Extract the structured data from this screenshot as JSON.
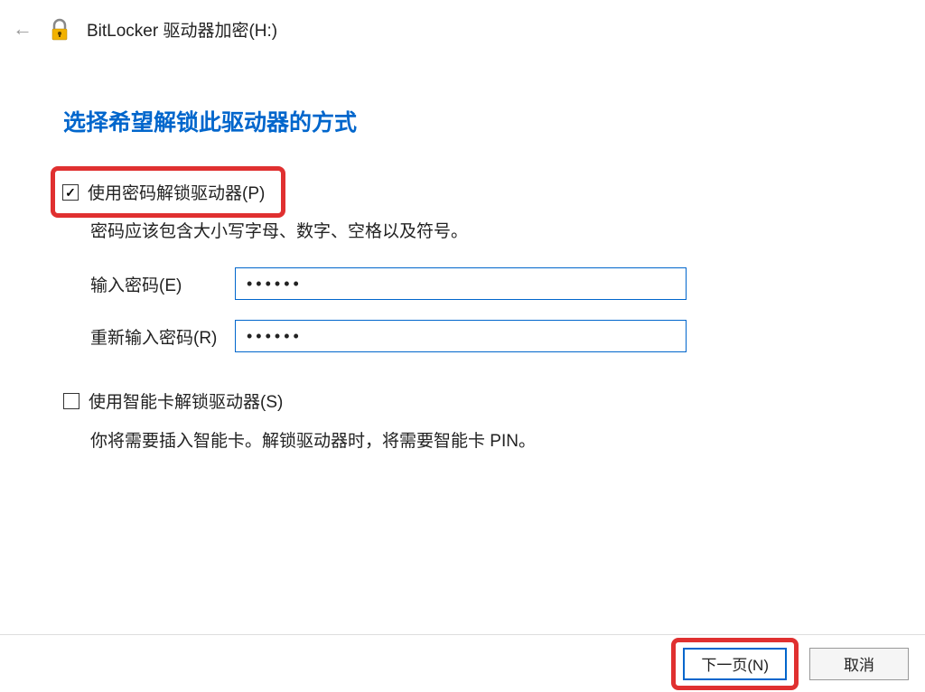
{
  "header": {
    "title": "BitLocker 驱动器加密(H:)"
  },
  "main": {
    "heading": "选择希望解锁此驱动器的方式",
    "usePassword": {
      "label": "使用密码解锁驱动器(P)",
      "checked": true,
      "desc": "密码应该包含大小写字母、数字、空格以及符号。",
      "enterLabel": "输入密码(E)",
      "enterValue": "••••••",
      "reenterLabel": "重新输入密码(R)",
      "reenterValue": "••••••"
    },
    "useSmartcard": {
      "label": "使用智能卡解锁驱动器(S)",
      "checked": false,
      "desc": "你将需要插入智能卡。解锁驱动器时，将需要智能卡 PIN。"
    }
  },
  "footer": {
    "next": "下一页(N)",
    "cancel": "取消"
  }
}
